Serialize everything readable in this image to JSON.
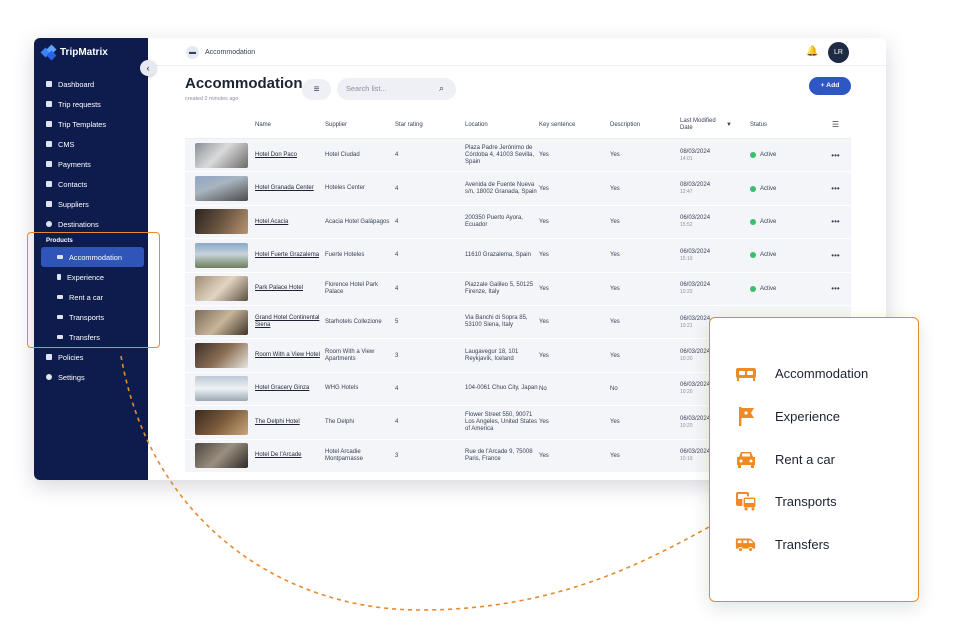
{
  "app": {
    "brand": "TripMatrix"
  },
  "sidebar": {
    "items": [
      {
        "label": "Dashboard",
        "icon": "dashboard-icon"
      },
      {
        "label": "Trip requests",
        "icon": "trip-requests-icon"
      },
      {
        "label": "Trip Templates",
        "icon": "trip-templates-icon"
      },
      {
        "label": "CMS",
        "icon": "cms-icon"
      },
      {
        "label": "Payments",
        "icon": "payments-icon"
      },
      {
        "label": "Contacts",
        "icon": "contacts-icon"
      },
      {
        "label": "Suppliers",
        "icon": "suppliers-icon"
      },
      {
        "label": "Destinations",
        "icon": "destinations-icon"
      }
    ],
    "section_label": "Products",
    "products": [
      {
        "label": "Accommodation",
        "active": true
      },
      {
        "label": "Experience"
      },
      {
        "label": "Rent a car"
      },
      {
        "label": "Transports"
      },
      {
        "label": "Transfers"
      }
    ],
    "bottom_items": [
      {
        "label": "Policies"
      },
      {
        "label": "Settings"
      }
    ]
  },
  "topbar": {
    "breadcrumb": "Accommodation",
    "avatar_initials": "LR"
  },
  "page": {
    "title": "Accommodation",
    "subtitle": "created 2 minutes ago",
    "search_placeholder": "Search list...",
    "add_label": "+ Add"
  },
  "table": {
    "columns": [
      "Name",
      "Supplier",
      "Star rating",
      "Location",
      "Key sentence",
      "Description",
      "Last Modified Date",
      "Status"
    ],
    "rows": [
      {
        "name": "Hotel Don Paco",
        "supplier": "Hotel Ciudad",
        "stars": "4",
        "location": "Plaza Padre Jerónimo de Córdoba 4, 41003 Sevilla, Spain",
        "key": "Yes",
        "desc": "Yes",
        "date": "08/03/2024",
        "time": "14:01",
        "status": "Active"
      },
      {
        "name": "Hotel Granada Center",
        "supplier": "Hoteles Center",
        "stars": "4",
        "location": "Avenida de Fuente Nueva s/n, 18002 Granada, Spain",
        "key": "Yes",
        "desc": "Yes",
        "date": "08/03/2024",
        "time": "12:47",
        "status": "Active"
      },
      {
        "name": "Hotel Acacia",
        "supplier": "Acacia Hotel Galápagos",
        "stars": "4",
        "location": "200350 Puerto Ayora, Ecuador",
        "key": "Yes",
        "desc": "Yes",
        "date": "06/03/2024",
        "time": "15:52",
        "status": "Active"
      },
      {
        "name": "Hotel Fuerte Grazalema",
        "supplier": "Fuerte Hoteles",
        "stars": "4",
        "location": "11610 Grazalema, Spain",
        "key": "Yes",
        "desc": "Yes",
        "date": "06/03/2024",
        "time": "15:19",
        "status": "Active"
      },
      {
        "name": "Park Palace Hotel",
        "supplier": "Florence Hotel Park Palace",
        "stars": "4",
        "location": "Piazzale Galileo 5, 50125 Firenze, Italy",
        "key": "Yes",
        "desc": "Yes",
        "date": "06/03/2024",
        "time": "10:22",
        "status": "Active"
      },
      {
        "name": "Grand Hotel Continental Siena",
        "supplier": "Starhotels Collezione",
        "stars": "5",
        "location": "Via Banchi di Sopra 85, 53100 Siena, Italy",
        "key": "Yes",
        "desc": "Yes",
        "date": "06/03/2024",
        "time": "10:21",
        "status": ""
      },
      {
        "name": "Room With a View Hotel",
        "supplier": "Room With a View Apartments",
        "stars": "3",
        "location": "Laugavegur 18, 101 Reykjavík, Iceland",
        "key": "Yes",
        "desc": "Yes",
        "date": "06/03/2024",
        "time": "10:20",
        "status": ""
      },
      {
        "name": "Hotel Gracery Ginza",
        "supplier": "WHG Hotels",
        "stars": "4",
        "location": "104-0061 Chuo City, Japan",
        "key": "No",
        "desc": "No",
        "date": "06/03/2024",
        "time": "10:20",
        "status": ""
      },
      {
        "name": "The Delphi Hotel",
        "supplier": "The Delphi",
        "stars": "4",
        "location": "Flower Street 550, 90071 Los Angeles, United States of America",
        "key": "Yes",
        "desc": "Yes",
        "date": "06/03/2024",
        "time": "10:20",
        "status": ""
      },
      {
        "name": "Hotel De l'Arcade",
        "supplier": "Hotel Arcadie Montparnasse",
        "stars": "3",
        "location": "Rue de l'Arcade 9, 75008 Paris, France",
        "key": "Yes",
        "desc": "Yes",
        "date": "06/03/2024",
        "time": "10:19",
        "status": ""
      }
    ]
  },
  "callout": {
    "items": [
      {
        "label": "Accommodation",
        "icon": "bed-icon"
      },
      {
        "label": "Experience",
        "icon": "flag-icon"
      },
      {
        "label": "Rent a car",
        "icon": "car-icon"
      },
      {
        "label": "Transports",
        "icon": "bus-icon"
      },
      {
        "label": "Transfers",
        "icon": "van-icon"
      }
    ]
  },
  "colors": {
    "sidebar_bg": "#0e1c4d",
    "active_item": "#2f55b8",
    "accent_orange": "#e58a2f",
    "primary_button": "#2e56c4",
    "status_active": "#3dbd6e"
  }
}
